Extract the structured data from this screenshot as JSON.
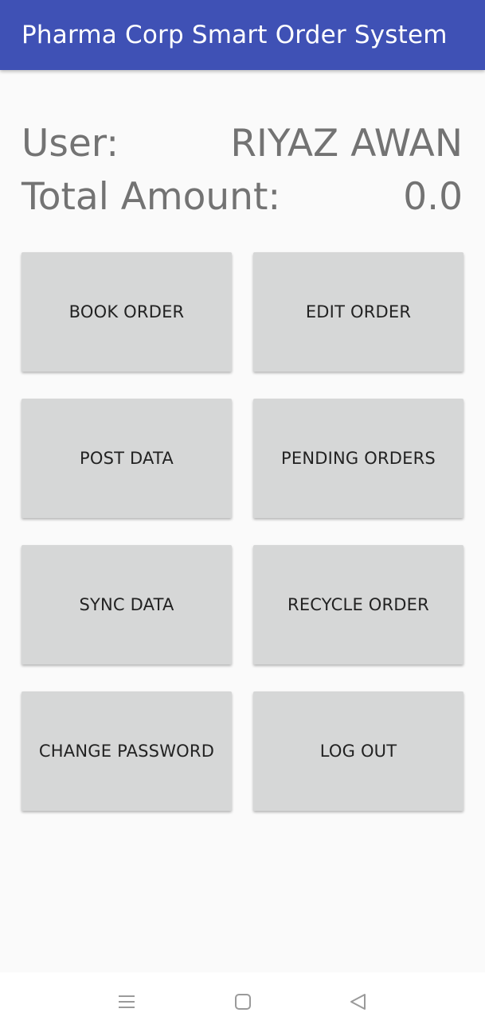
{
  "app_bar": {
    "title": "Pharma Corp Smart Order System",
    "color": "#3f51b5"
  },
  "info": {
    "user_label": "User:",
    "user_value": "RIYAZ AWAN",
    "amount_label": "Total Amount:",
    "amount_value": "0.0"
  },
  "buttons": [
    {
      "label": "BOOK ORDER"
    },
    {
      "label": "EDIT ORDER"
    },
    {
      "label": "POST DATA"
    },
    {
      "label": "PENDING ORDERS"
    },
    {
      "label": "SYNC DATA"
    },
    {
      "label": "RECYCLE ORDER"
    },
    {
      "label": "CHANGE PASSWORD"
    },
    {
      "label": "LOG OUT"
    }
  ],
  "nav_bar": {
    "icons": [
      "menu-icon",
      "home-square-icon",
      "back-triangle-icon"
    ]
  }
}
